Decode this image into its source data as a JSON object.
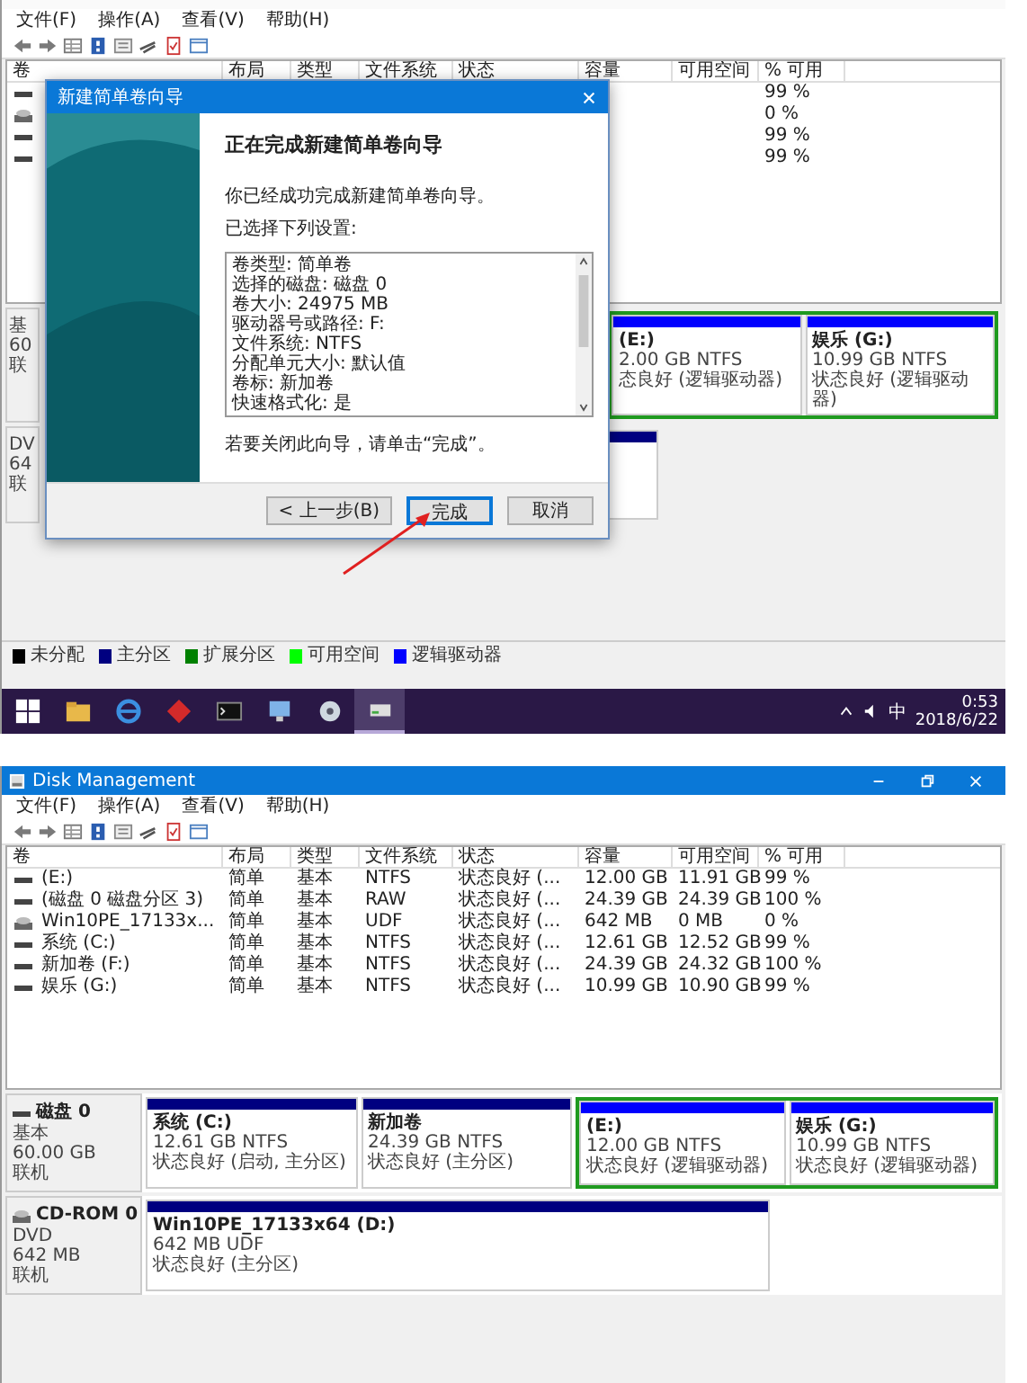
{
  "top_screen": {
    "menu": [
      "文件(F)",
      "操作(A)",
      "查看(V)",
      "帮助(H)"
    ],
    "columns": [
      "卷",
      "布局",
      "类型",
      "文件系统",
      "状态",
      "容量",
      "可用空间",
      "% 可用"
    ],
    "rows": [
      {
        "kind": "disk",
        "percent_free": "99 %"
      },
      {
        "kind": "optical",
        "percent_free": "0 %"
      },
      {
        "kind": "disk",
        "percent_free": "99 %"
      },
      {
        "kind": "disk",
        "percent_free": "99 %"
      }
    ],
    "disks": [
      {
        "details": [
          "基",
          "60",
          "联"
        ],
        "partitions": [
          {
            "kind": "logical",
            "name": "(E:)",
            "size": "2.00 GB NTFS",
            "status": "态良好 (逻辑驱动器)"
          },
          {
            "kind": "logical",
            "name": "娱乐 (G:)",
            "size": "10.99 GB NTFS",
            "status": "状态良好 (逻辑驱动器)"
          }
        ]
      },
      {
        "details": [
          "DV",
          "64",
          "联"
        ],
        "partitions": [
          {
            "kind": "primary"
          }
        ]
      }
    ],
    "legend": [
      {
        "label": "未分配",
        "color": "#000000"
      },
      {
        "label": "主分区",
        "color": "#000080"
      },
      {
        "label": "扩展分区",
        "color": "#008000"
      },
      {
        "label": "可用空间",
        "color": "#00ff00"
      },
      {
        "label": "逻辑驱动器",
        "color": "#0000ff"
      }
    ],
    "dialog": {
      "title": "新建简单卷向导",
      "heading": "正在完成新建简单卷向导",
      "message": "你已经成功完成新建简单卷向导。",
      "settings_label": "已选择下列设置:",
      "settings": [
        "卷类型: 简单卷",
        "选择的磁盘: 磁盘 0",
        "卷大小: 24975 MB",
        "驱动器号或路径: F:",
        "文件系统: NTFS",
        "分配单元大小: 默认值",
        "卷标: 新加卷",
        "快速格式化: 是"
      ],
      "footer": "若要关闭此向导，请单击“完成”。",
      "buttons": [
        {
          "label": "< 上一步(B)",
          "focused": false
        },
        {
          "label": "完成",
          "focused": true
        },
        {
          "label": "取消",
          "focused": false
        }
      ]
    },
    "taskbar": {
      "apps": [
        {
          "kind": "start",
          "selected": false
        },
        {
          "kind": "folder",
          "selected": false
        },
        {
          "kind": "browser",
          "selected": false
        },
        {
          "kind": "diamond",
          "selected": false
        },
        {
          "kind": "terminal",
          "selected": false
        },
        {
          "kind": "network",
          "selected": false
        },
        {
          "kind": "disc",
          "selected": false
        },
        {
          "kind": "drive",
          "selected": true
        }
      ],
      "input_method": "中",
      "time": "0:53",
      "date": "2018/6/22"
    }
  },
  "bottom_screen": {
    "title": "Disk Management",
    "menu": [
      "文件(F)",
      "操作(A)",
      "查看(V)",
      "帮助(H)"
    ],
    "columns": [
      "卷",
      "布局",
      "类型",
      "文件系统",
      "状态",
      "容量",
      "可用空间",
      "% 可用"
    ],
    "rows": [
      {
        "kind": "disk",
        "volume": "(E:)",
        "layout": "简单",
        "type": "基本",
        "file_system": "NTFS",
        "status": "状态良好 (...",
        "capacity": "12.00 GB",
        "free_space": "11.91 GB",
        "percent_free": "99 %"
      },
      {
        "kind": "disk",
        "volume": "(磁盘 0 磁盘分区 3)",
        "layout": "简单",
        "type": "基本",
        "file_system": "RAW",
        "status": "状态良好 (...",
        "capacity": "24.39 GB",
        "free_space": "24.39 GB",
        "percent_free": "100 %"
      },
      {
        "kind": "optical",
        "volume": "Win10PE_17133x...",
        "layout": "简单",
        "type": "基本",
        "file_system": "UDF",
        "status": "状态良好 (...",
        "capacity": "642 MB",
        "free_space": "0 MB",
        "percent_free": "0 %"
      },
      {
        "kind": "disk",
        "volume": "系统 (C:)",
        "layout": "简单",
        "type": "基本",
        "file_system": "NTFS",
        "status": "状态良好 (...",
        "capacity": "12.61 GB",
        "free_space": "12.52 GB",
        "percent_free": "99 %"
      },
      {
        "kind": "disk",
        "volume": "新加卷 (F:)",
        "layout": "简单",
        "type": "基本",
        "file_system": "NTFS",
        "status": "状态良好 (...",
        "capacity": "24.39 GB",
        "free_space": "24.32 GB",
        "percent_free": "100 %"
      },
      {
        "kind": "disk",
        "volume": "娱乐 (G:)",
        "layout": "简单",
        "type": "基本",
        "file_system": "NTFS",
        "status": "状态良好 (...",
        "capacity": "10.99 GB",
        "free_space": "10.90 GB",
        "percent_free": "99 %"
      }
    ],
    "disks": [
      {
        "kind": "disk",
        "name": "磁盘 0",
        "details": [
          "基本",
          "60.00 GB",
          "联机"
        ],
        "partitions": [
          {
            "kind": "primary",
            "name": "系统 (C:)",
            "size": "12.61 GB NTFS",
            "status": "状态良好 (启动, 主分区)"
          },
          {
            "kind": "primary",
            "name": "新加卷",
            "size": "24.39 GB NTFS",
            "status": "状态良好 (主分区)"
          },
          {
            "kind": "logical",
            "name": "(E:)",
            "size": "12.00 GB NTFS",
            "status": "状态良好 (逻辑驱动器)"
          },
          {
            "kind": "logical",
            "name": "娱乐 (G:)",
            "size": "10.99 GB NTFS",
            "status": "状态良好 (逻辑驱动器)"
          }
        ]
      },
      {
        "kind": "optical",
        "name": "CD-ROM 0",
        "details": [
          "DVD",
          "642 MB",
          "联机"
        ],
        "partitions": [
          {
            "kind": "primary",
            "name": "Win10PE_17133x64 (D:)",
            "size": "642 MB UDF",
            "status": "状态良好 (主分区)"
          }
        ]
      }
    ]
  }
}
